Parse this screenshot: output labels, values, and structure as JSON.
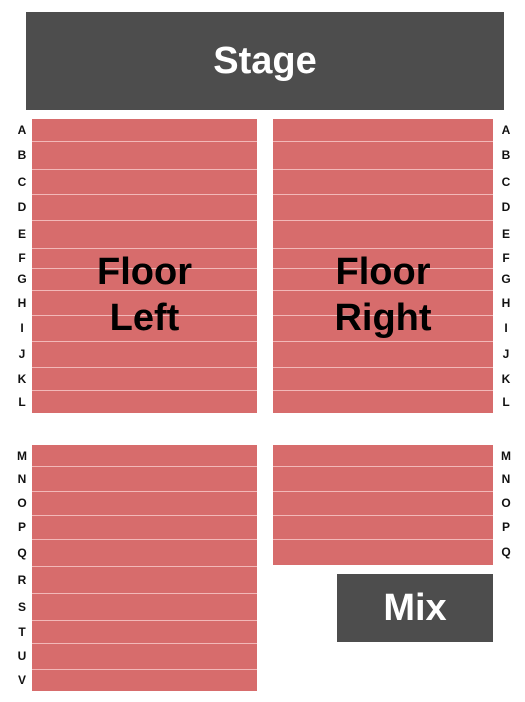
{
  "venue_map": {
    "stage_label": "Stage",
    "mix_label": "Mix",
    "seat_color": "#d76c6c",
    "block_color": "#4d4d4d",
    "sections": [
      {
        "id": "floor-left-front",
        "title_line1": "Floor",
        "title_line2": "Left",
        "rows": [
          "A",
          "B",
          "C",
          "D",
          "E",
          "F",
          "G",
          "H",
          "I",
          "J",
          "K",
          "L"
        ]
      },
      {
        "id": "floor-right-front",
        "title_line1": "Floor",
        "title_line2": "Right",
        "rows": [
          "A",
          "B",
          "C",
          "D",
          "E",
          "F",
          "G",
          "H",
          "I",
          "J",
          "K",
          "L"
        ]
      },
      {
        "id": "floor-left-rear",
        "title_line1": "",
        "title_line2": "",
        "rows": [
          "M",
          "N",
          "O",
          "P",
          "Q",
          "R",
          "S",
          "T",
          "U",
          "V"
        ]
      },
      {
        "id": "floor-right-rear",
        "title_line1": "",
        "title_line2": "",
        "rows": [
          "M",
          "N",
          "O",
          "P",
          "Q"
        ]
      }
    ]
  }
}
